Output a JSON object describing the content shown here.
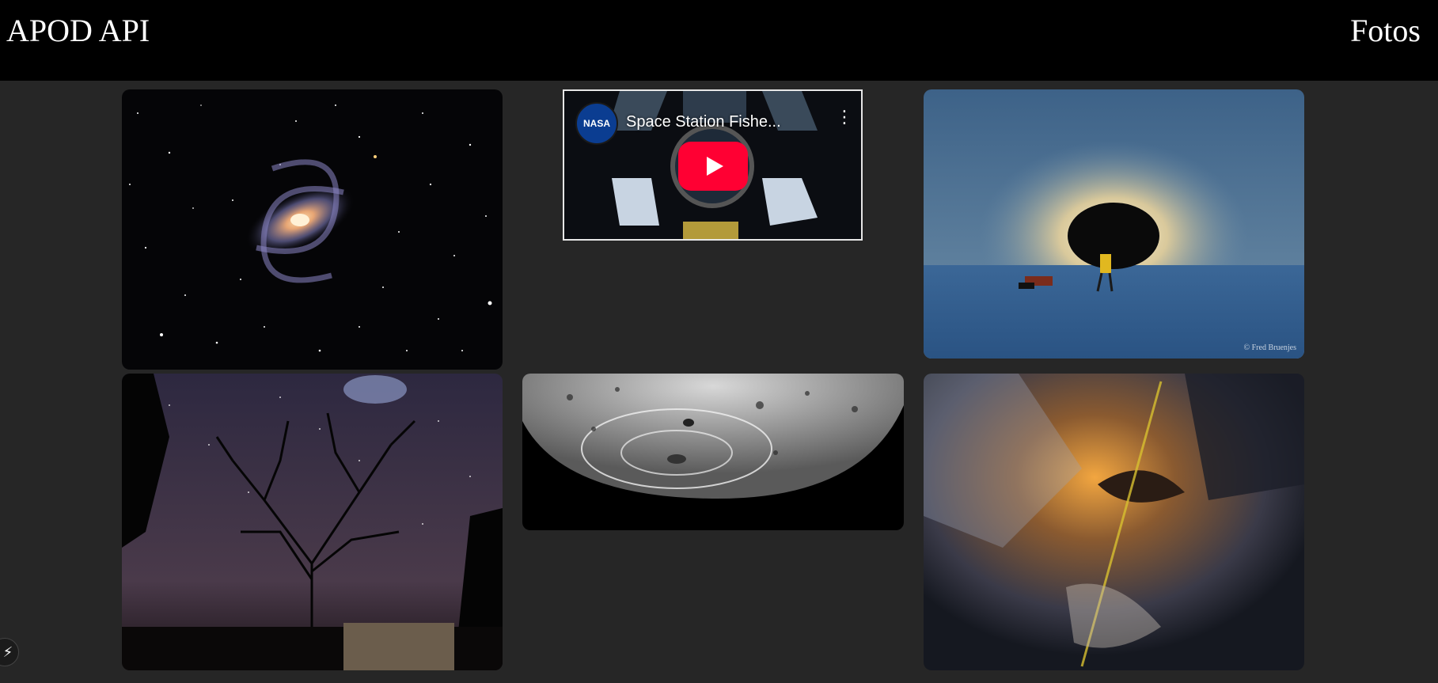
{
  "header": {
    "brand": "APOD API",
    "nav": {
      "fotos": "Fotos"
    }
  },
  "gallery": {
    "items": [
      {
        "kind": "image",
        "subject": "barred spiral galaxy"
      },
      {
        "kind": "video",
        "title": "Space Station Fishe...",
        "channel_logo": "NASA",
        "icons": [
          "play-icon",
          "more-vertical-icon"
        ]
      },
      {
        "kind": "image",
        "subject": "total solar eclipse over ice",
        "credit": "© Fred Bruenjes"
      },
      {
        "kind": "image",
        "subject": "tree silhouette under starry sky"
      },
      {
        "kind": "image",
        "subject": "moon south pole close-up"
      },
      {
        "kind": "image",
        "subject": "nebula jet"
      }
    ]
  },
  "floating_button": {
    "icon": "lightning-icon",
    "glyph": "⚡"
  },
  "colors": {
    "header_bg": "#000000",
    "page_bg": "#262626",
    "play_red": "#ff0033"
  }
}
